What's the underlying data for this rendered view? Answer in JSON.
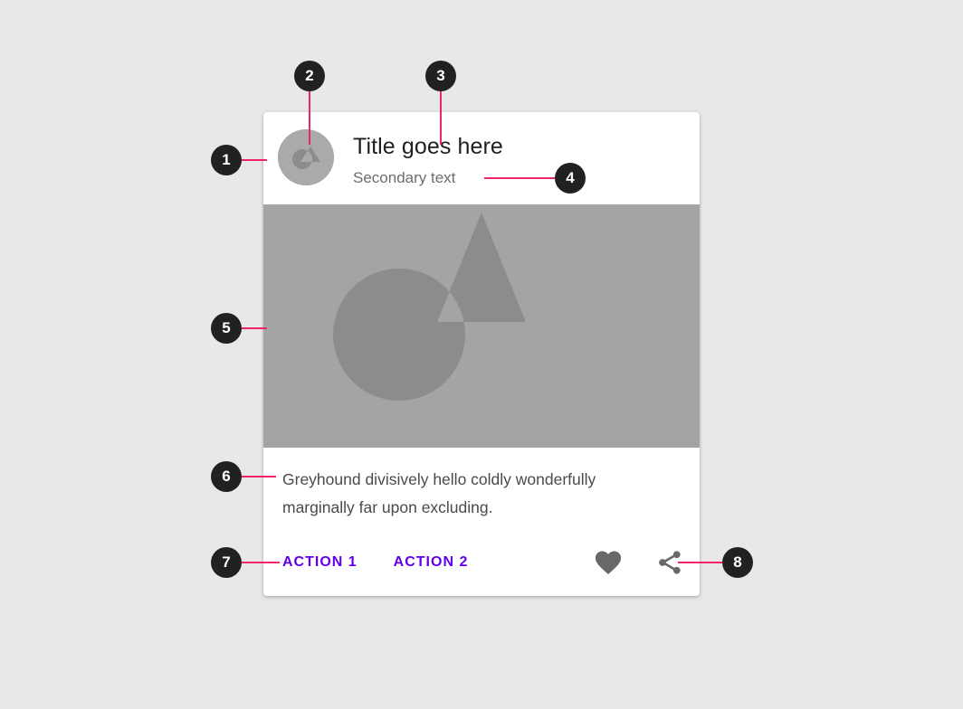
{
  "page": {
    "background_color": "#e8e8e8",
    "description": "Annotated Material Design card anatomy diagram"
  },
  "card": {
    "background_color": "#ffffff",
    "header": {
      "avatar": {
        "icon": "avatar-placeholder-icon",
        "background_color": "#aaaaaa"
      },
      "title": "Title goes here",
      "secondary_text": "Secondary text"
    },
    "media": {
      "icon": "image-placeholder-icon",
      "background_color": "#a4a4a4"
    },
    "supporting_text": "Greyhound divisively hello coldly wonderfully marginally far upon excluding.",
    "actions": {
      "accent_color": "#6200ee",
      "buttons": [
        {
          "label": "ACTION 1",
          "name": "action-1-button"
        },
        {
          "label": "ACTION 2",
          "name": "action-2-button"
        }
      ],
      "icons": [
        {
          "label": "favorite",
          "name": "heart-icon"
        },
        {
          "label": "share",
          "name": "share-icon"
        }
      ]
    }
  },
  "callouts": {
    "badge_color": "#212121",
    "leader_color": "#f2236b",
    "items": [
      {
        "number": "1",
        "target": "card container"
      },
      {
        "number": "2",
        "target": "avatar"
      },
      {
        "number": "3",
        "target": "title"
      },
      {
        "number": "4",
        "target": "secondary text"
      },
      {
        "number": "5",
        "target": "media"
      },
      {
        "number": "6",
        "target": "supporting text"
      },
      {
        "number": "7",
        "target": "buttons"
      },
      {
        "number": "8",
        "target": "icons"
      }
    ]
  }
}
